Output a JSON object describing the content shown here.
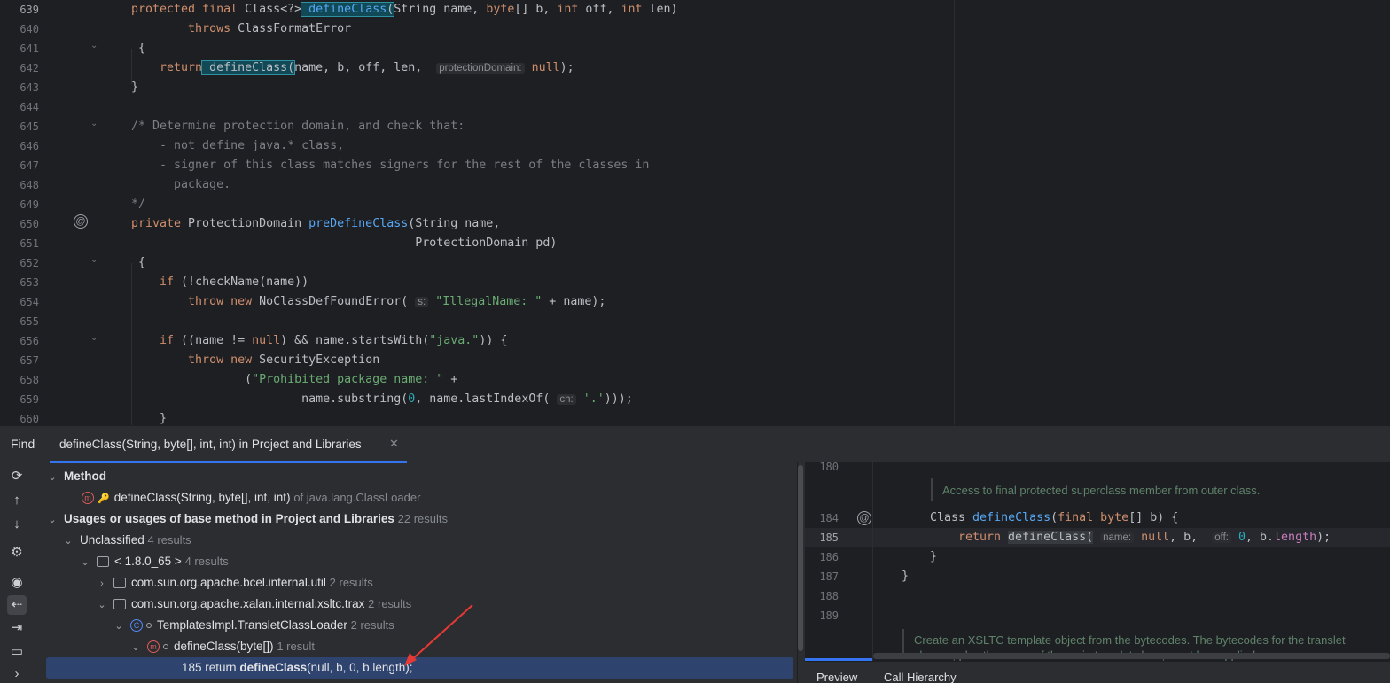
{
  "editor": {
    "line_numbers": [
      "639",
      "640",
      "641",
      "642",
      "643",
      "644",
      "645",
      "646",
      "647",
      "648",
      "649",
      "650",
      "651",
      "652",
      "653",
      "654",
      "655",
      "656",
      "657",
      "658",
      "659",
      "660"
    ],
    "hints": {
      "protection_domain": "protectionDomain:",
      "s": "s:",
      "ch": "ch:"
    }
  },
  "find": {
    "title": "Find",
    "tab_label": "defineClass(String, byte[], int, int) in Project and Libraries",
    "tree": {
      "method_header": "Method",
      "method_sig": "defineClass(String, byte[], int, int)",
      "method_owner": "of java.lang.ClassLoader",
      "usages_header": "Usages or usages of base method in Project and Libraries",
      "usages_count": "22 results",
      "unclassified": "Unclassified",
      "unclassified_count": "4 results",
      "jdk": "< 1.8.0_65 >",
      "jdk_count": "4 results",
      "pkg_bcel": "com.sun.org.apache.bcel.internal.util",
      "pkg_bcel_count": "2 results",
      "pkg_xalan": "com.sun.org.apache.xalan.internal.xsltc.trax",
      "pkg_xalan_count": "2 results",
      "class_name": "TemplatesImpl.TransletClassLoader",
      "class_count": "2 results",
      "method_name": "defineClass(byte[])",
      "method_count": "1 result",
      "usage_line_no": "185",
      "usage_pre": "return",
      "usage_match": "defineClass",
      "usage_post": "(null, b, 0, b.length);"
    }
  },
  "preview": {
    "line_numbers": [
      "180",
      "184",
      "185",
      "186",
      "187",
      "188",
      "189"
    ],
    "doc1": "Access to final protected superclass member from outer class.",
    "doc2a": "Create an XSLTC template object from the bytecodes. The bytecodes for the translet",
    "doc2b": "classes, plus the name of the main translet class, must be supplied.",
    "hint_name": "name:",
    "hint_off": "off:",
    "tabs": [
      "Preview",
      "Call Hierarchy"
    ]
  },
  "colors": {
    "accent": "#3574f0",
    "selection": "#2e436e",
    "keyword": "#cf8e6d",
    "function": "#56a8f5",
    "string": "#6aab73",
    "number": "#2aacb8",
    "arrow": "#e53935"
  }
}
